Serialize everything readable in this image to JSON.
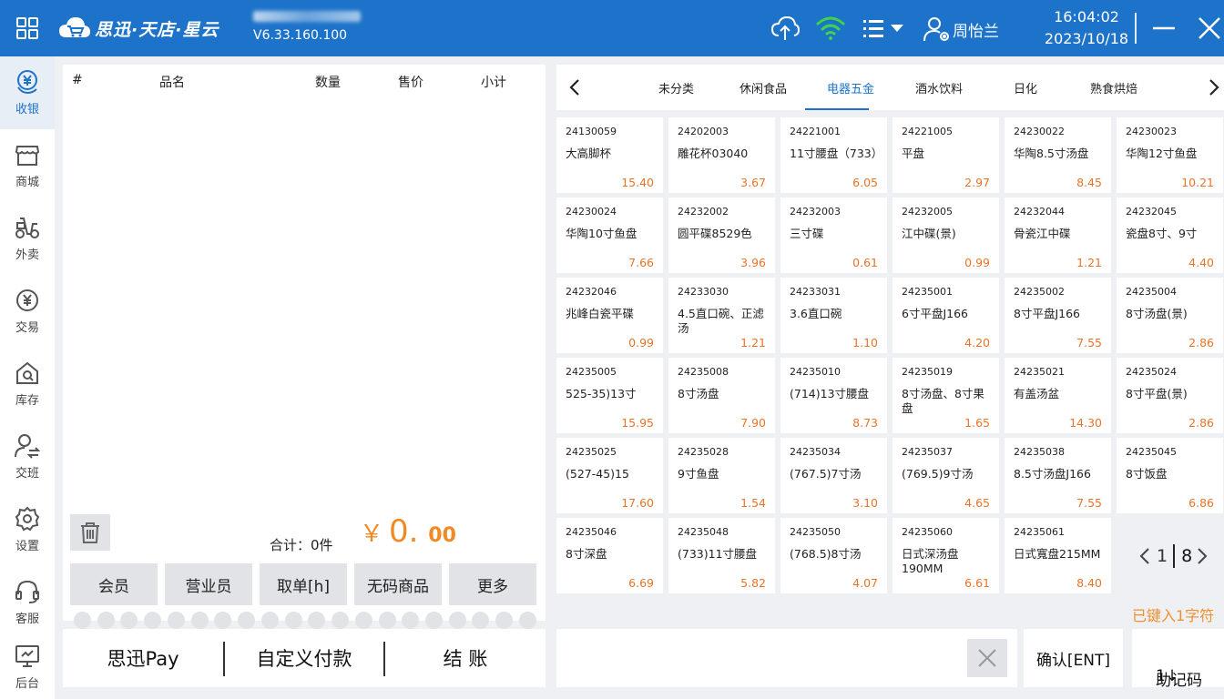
{
  "header": {
    "brand": "思迅·天店·星云",
    "version": "V6.33.160.100",
    "user": "周怡兰",
    "time": "16:04:02",
    "date": "2023/10/18"
  },
  "sidebar": {
    "items": [
      {
        "label": "收银",
        "icon": "cashier-yuan-icon",
        "active": true
      },
      {
        "label": "商城",
        "icon": "shop-icon"
      },
      {
        "label": "外卖",
        "icon": "scooter-icon"
      },
      {
        "label": "交易",
        "icon": "yuan-circle-icon"
      },
      {
        "label": "库存",
        "icon": "warehouse-icon"
      },
      {
        "label": "交班",
        "icon": "user-switch-icon"
      },
      {
        "label": "设置",
        "icon": "gear-icon"
      },
      {
        "label": "客服",
        "icon": "headset-icon"
      },
      {
        "label": "后台",
        "icon": "monitor-icon"
      }
    ]
  },
  "cart": {
    "columns": [
      "#",
      "品名",
      "数量",
      "售价",
      "小计"
    ],
    "total_label": "合计：0件",
    "currency": "￥",
    "total_int": "0.",
    "total_dec": "00",
    "buttons": [
      "会员",
      "营业员",
      "取单[h]",
      "无码商品",
      "更多"
    ]
  },
  "payment": {
    "buttons": [
      "思迅Pay",
      "自定义付款",
      "结 账"
    ]
  },
  "categories": {
    "tabs": [
      "未分类",
      "休闲食品",
      "电器五金",
      "酒水饮料",
      "日化",
      "熟食烘焙"
    ],
    "active_index": 2
  },
  "products": [
    {
      "code": "24130059",
      "name": "大高脚杯",
      "price": "15.40"
    },
    {
      "code": "24202003",
      "name": "雕花杯03040",
      "price": "3.67"
    },
    {
      "code": "24221001",
      "name": "11寸腰盘（733）",
      "price": "6.05"
    },
    {
      "code": "24221005",
      "name": "平盘",
      "price": "2.97"
    },
    {
      "code": "24230022",
      "name": "华陶8.5寸汤盘",
      "price": "8.45"
    },
    {
      "code": "24230023",
      "name": "华陶12寸鱼盘",
      "price": "10.21"
    },
    {
      "code": "24230024",
      "name": "华陶10寸鱼盘",
      "price": "7.66"
    },
    {
      "code": "24232002",
      "name": "圆平碟8529色",
      "price": "3.96"
    },
    {
      "code": "24232003",
      "name": "三寸碟",
      "price": "0.61"
    },
    {
      "code": "24232005",
      "name": "江中碟(景)",
      "price": "0.99"
    },
    {
      "code": "24232044",
      "name": "骨瓷江中碟",
      "price": "1.21"
    },
    {
      "code": "24232045",
      "name": "瓷盘8寸、9寸",
      "price": "4.40"
    },
    {
      "code": "24232046",
      "name": "兆峰白瓷平碟",
      "price": "0.99"
    },
    {
      "code": "24233030",
      "name": "4.5直口碗、正滤汤",
      "price": "1.21"
    },
    {
      "code": "24233031",
      "name": "3.6直口碗",
      "price": "1.10"
    },
    {
      "code": "24235001",
      "name": "6寸平盘J166",
      "price": "4.20"
    },
    {
      "code": "24235002",
      "name": "8寸平盘J166",
      "price": "7.55"
    },
    {
      "code": "24235004",
      "name": "8寸汤盘(景)",
      "price": "2.86"
    },
    {
      "code": "24235005",
      "name": "525-35)13寸",
      "price": "15.95"
    },
    {
      "code": "24235008",
      "name": "8寸汤盘",
      "price": "7.90"
    },
    {
      "code": "24235010",
      "name": "(714)13寸腰盘",
      "price": "8.73"
    },
    {
      "code": "24235019",
      "name": "8寸汤盘、8寸果盘",
      "price": "1.65"
    },
    {
      "code": "24235021",
      "name": "有盖汤盆",
      "price": "14.30"
    },
    {
      "code": "24235024",
      "name": "8寸平盘(景)",
      "price": "2.86"
    },
    {
      "code": "24235025",
      "name": "(527-45)15",
      "price": "17.60"
    },
    {
      "code": "24235028",
      "name": "9寸鱼盘",
      "price": "1.54"
    },
    {
      "code": "24235034",
      "name": "(767.5)7寸汤",
      "price": "3.10"
    },
    {
      "code": "24235037",
      "name": "(769.5)9寸汤",
      "price": "4.65"
    },
    {
      "code": "24235038",
      "name": "8.5寸汤盘J166",
      "price": "7.55"
    },
    {
      "code": "24235045",
      "name": "8寸饭盘",
      "price": "6.86"
    },
    {
      "code": "24235046",
      "name": "8寸深盘",
      "price": "6.69"
    },
    {
      "code": "24235048",
      "name": "(733)11寸腰盘",
      "price": "5.82"
    },
    {
      "code": "24235050",
      "name": "(768.5)8寸汤",
      "price": "4.07"
    },
    {
      "code": "24235060",
      "name": "日式深汤盘190MM",
      "price": "6.61"
    },
    {
      "code": "24235061",
      "name": "日式寬盘215MM",
      "price": "8.40"
    }
  ],
  "pager": {
    "current": "1",
    "total": "8"
  },
  "input": {
    "typed_hint": "已键入1字符",
    "confirm": "确认[ENT]",
    "mnemonic": "助记码",
    "mnemonic_extra": "1↓"
  }
}
